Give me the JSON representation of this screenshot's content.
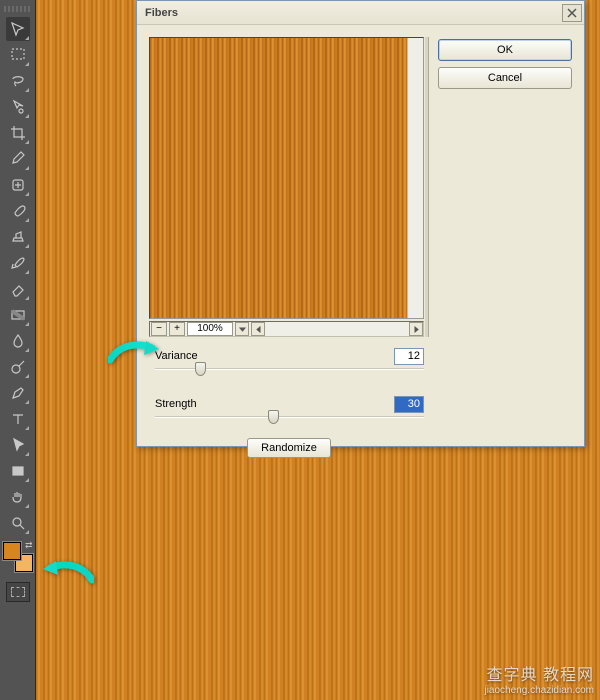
{
  "dialog": {
    "title": "Fibers",
    "ok_label": "OK",
    "cancel_label": "Cancel",
    "zoom_pct": "100%",
    "zoom_minus": "−",
    "zoom_plus": "+",
    "variance": {
      "label": "Variance",
      "value": "12",
      "pos_pct": 15
    },
    "strength": {
      "label": "Strength",
      "value": "30",
      "pos_pct": 42
    },
    "randomize_label": "Randomize"
  },
  "colors": {
    "foreground": "#d7851c",
    "background": "#f2b560",
    "canvas_wood": "#d88a24"
  },
  "tools": [
    "move",
    "rect-marquee",
    "lasso",
    "quick-select",
    "crop",
    "eyedropper",
    "healing-brush",
    "brush",
    "clone-stamp",
    "history-brush",
    "eraser",
    "gradient",
    "blur",
    "dodge",
    "pen",
    "type",
    "path-select",
    "rectangle",
    "hand",
    "zoom"
  ],
  "watermark": {
    "line1": "查字典 教程网",
    "line2": "jiaocheng.chazidian.com"
  }
}
